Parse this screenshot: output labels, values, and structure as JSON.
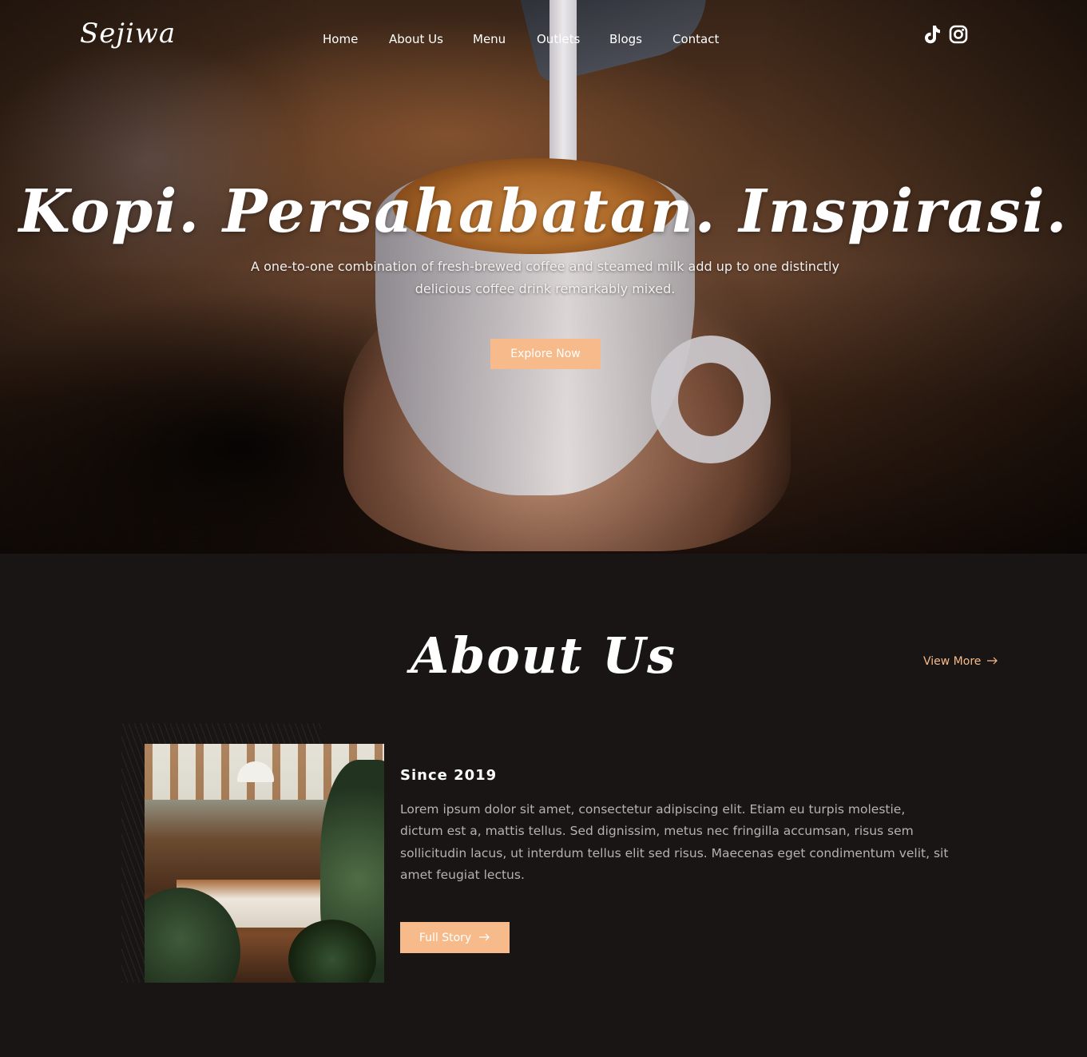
{
  "brand": {
    "logo_text": "Sejiwa"
  },
  "nav": {
    "items": [
      "Home",
      "About Us",
      "Menu",
      "Outlets",
      "Blogs",
      "Contact"
    ]
  },
  "social": {
    "icons": [
      "tiktok-icon",
      "instagram-icon"
    ]
  },
  "hero": {
    "title": "Kopi. Persahabatan. Inspirasi.",
    "subtitle": "A one-to-one combination of fresh-brewed coffee and steamed milk add up to one distinctly delicious coffee drink remarkably mixed.",
    "cta_label": "Explore Now"
  },
  "about": {
    "title": "About Us",
    "view_more_label": "View More",
    "heading": "Since 2019",
    "body": "Lorem ipsum dolor sit amet, consectetur adipiscing elit. Etiam eu turpis molestie, dictum est a, mattis tellus. Sed dignissim, metus nec fringilla accumsan, risus sem sollicitudin lacus, ut interdum tellus elit sed risus. Maecenas eget condimentum velit, sit amet feugiat lectus.",
    "cta_label": "Full Story",
    "arrow_icon": "arrow-right-icon"
  },
  "colors": {
    "accent": "#f7bb8b",
    "background": "#181514",
    "text": "#ffffff",
    "muted_text": "#b7b2ad"
  }
}
